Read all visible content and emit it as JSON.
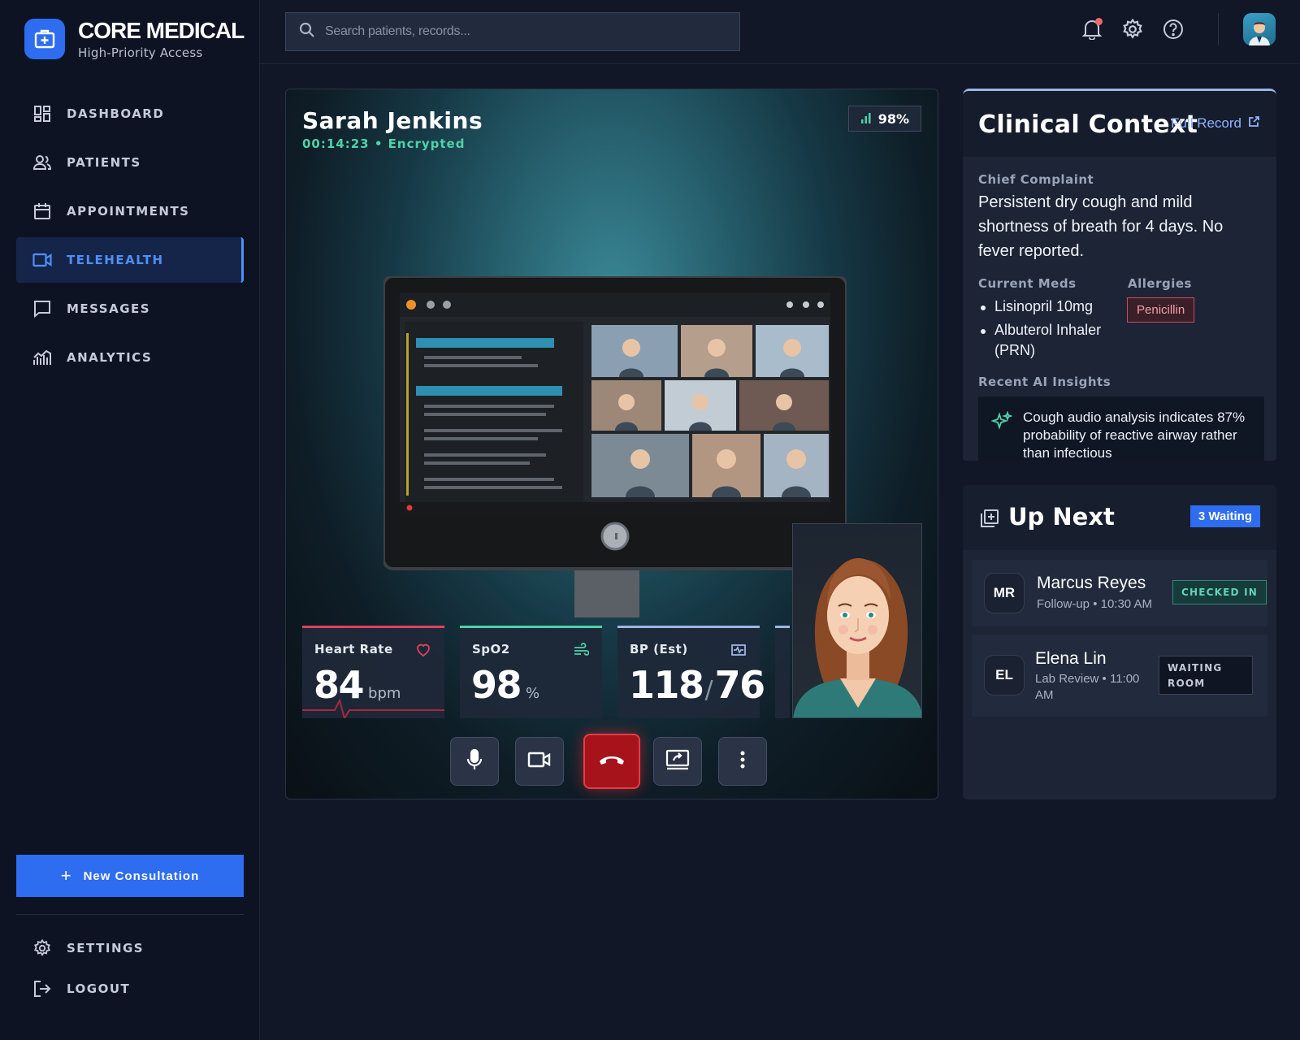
{
  "brand": {
    "title": "CORE MEDICAL",
    "subtitle": "High-Priority Access",
    "logo_icon": "medical-kit-icon",
    "accent": "#2e6cf0"
  },
  "sidebar": {
    "items": [
      {
        "label": "DASHBOARD",
        "icon": "dashboard-icon",
        "active": false
      },
      {
        "label": "PATIENTS",
        "icon": "patients-icon",
        "active": false
      },
      {
        "label": "APPOINTMENTS",
        "icon": "calendar-icon",
        "active": false
      },
      {
        "label": "TELEHEALTH",
        "icon": "video-camera-icon",
        "active": true
      },
      {
        "label": "MESSAGES",
        "icon": "message-icon",
        "active": false
      },
      {
        "label": "ANALYTICS",
        "icon": "analytics-icon",
        "active": false
      }
    ],
    "new_consultation": "New Consultation",
    "bottom_items": [
      {
        "label": "SETTINGS",
        "icon": "gear-icon"
      },
      {
        "label": "LOGOUT",
        "icon": "logout-icon"
      }
    ]
  },
  "topbar": {
    "search_placeholder": "Search patients, records...",
    "icons": [
      "bell-icon",
      "gear-icon",
      "help-icon"
    ],
    "notification_dot_color": "#f06a6a"
  },
  "call": {
    "patient_name": "Sarah Jenkins",
    "meta": "00:14:23 • Encrypted",
    "signal": "98%",
    "vitals": [
      {
        "label": "Heart Rate",
        "value": "84",
        "unit": "bpm",
        "icon": "heart-icon",
        "color": "#e04060"
      },
      {
        "label": "SpO2",
        "value": "98",
        "unit": "%",
        "icon": "wind-icon",
        "color": "#4fd2a6"
      },
      {
        "label": "BP (Est)",
        "value": "118",
        "value2": "76",
        "icon": "pulse-monitor-icon",
        "color": "#9fb4e4"
      }
    ],
    "controls": [
      "microphone-icon",
      "camera-icon",
      "end-call-icon",
      "screen-share-icon",
      "more-icon"
    ]
  },
  "clinical": {
    "title": "Clinical Context",
    "full_record": "Full Record",
    "chief_complaint_label": "Chief Complaint",
    "chief_complaint": "Persistent dry cough and mild shortness of breath for 4 days. No fever reported.",
    "meds_label": "Current Meds",
    "meds": [
      "Lisinopril 10mg",
      "Albuterol Inhaler (PRN)"
    ],
    "allergies_label": "Allergies",
    "allergies": [
      "Penicillin"
    ],
    "insights_label": "Recent AI Insights",
    "insight": "Cough audio analysis indicates 87% probability of reactive airway rather than infectious"
  },
  "up_next": {
    "title": "Up Next",
    "badge": "3 Waiting",
    "queue": [
      {
        "initials": "MR",
        "name": "Marcus Reyes",
        "meta": "Follow-up • 10:30 AM",
        "status": "CHECKED IN"
      },
      {
        "initials": "EL",
        "name": "Elena Lin",
        "meta": "Lab Review • 11:00 AM",
        "status": "WAITING ROOM"
      }
    ]
  }
}
